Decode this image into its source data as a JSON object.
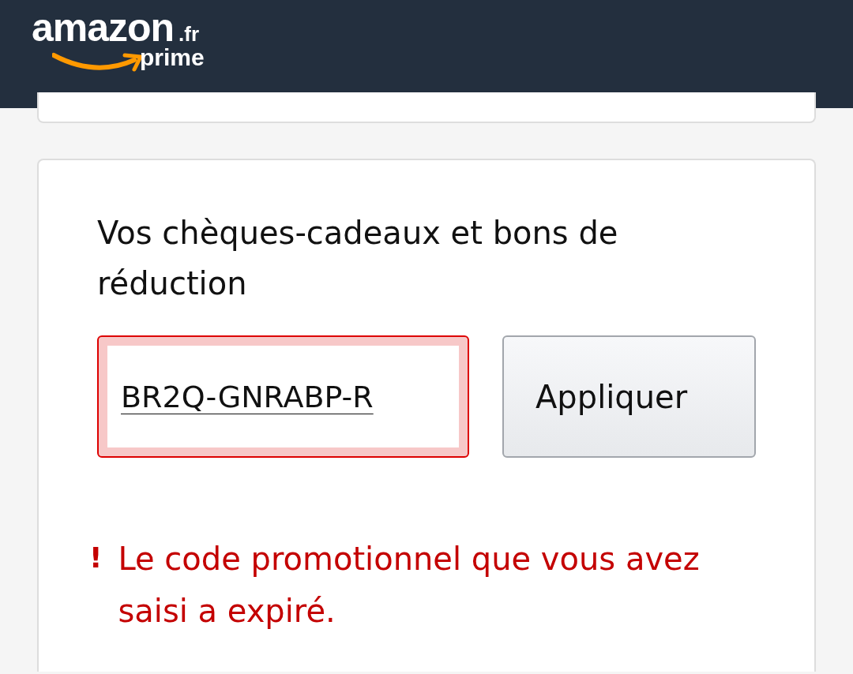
{
  "header": {
    "logo": {
      "wordmark": "amazon",
      "domain": ".fr",
      "sub": "prime"
    }
  },
  "gift_card": {
    "title": "Vos chèques-cadeaux et bons de réduction",
    "code_field": {
      "value": "BR2Q-GNRABP-R",
      "invalid": true
    },
    "apply_button": "Appliquer",
    "error": {
      "icon": "!",
      "message": "Le code promotionnel que vous avez saisi a expiré."
    }
  }
}
